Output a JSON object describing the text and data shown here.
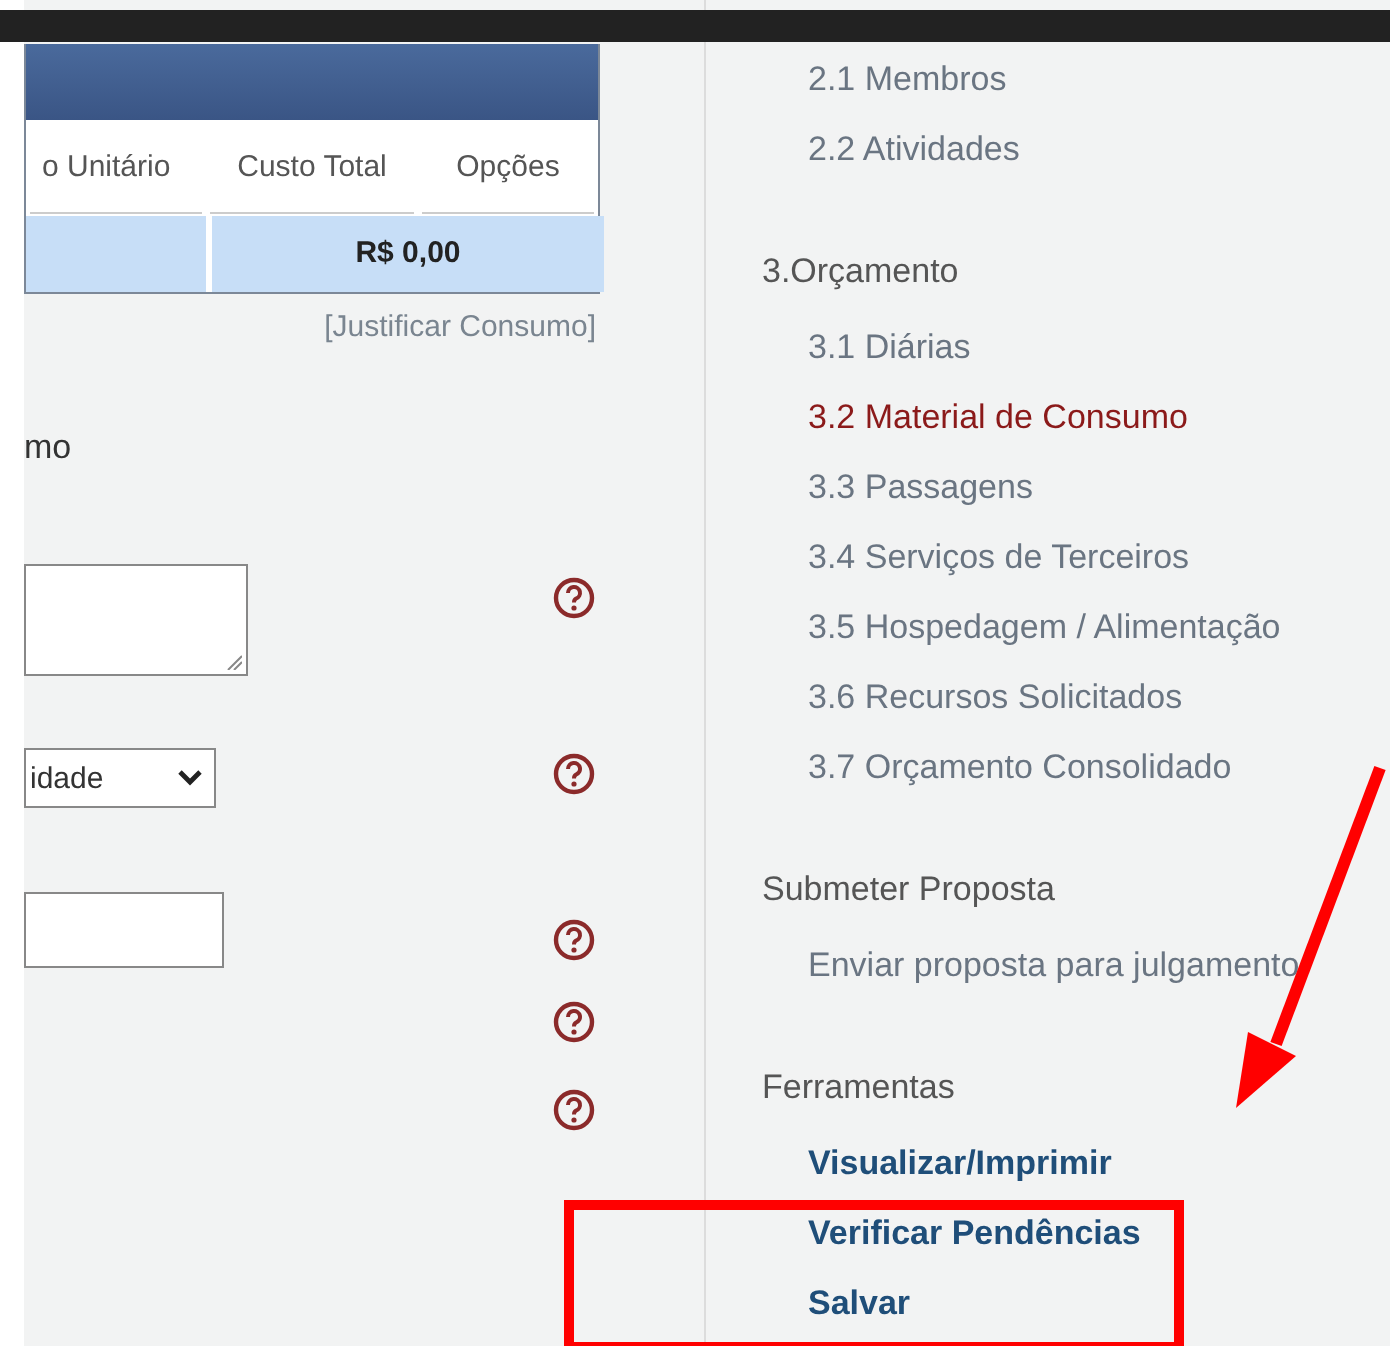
{
  "table": {
    "columns": [
      "o Unitário",
      "Custo Total",
      "Opções"
    ],
    "total": "R$ 0,00",
    "link": "[Justificar Consumo]"
  },
  "form": {
    "section_title": "mo",
    "fields": [
      {
        "kind": "textarea"
      },
      {
        "kind": "select",
        "value": "idade"
      },
      {
        "kind": "input"
      },
      {
        "kind": "none"
      },
      {
        "kind": "none"
      }
    ]
  },
  "sidebar": {
    "sections": [
      {
        "items": [
          {
            "label": "2.1 Membros",
            "kind": "page",
            "selected": false
          },
          {
            "label": "2.2 Atividades",
            "kind": "page",
            "selected": false
          }
        ]
      },
      {
        "title": "3.Orçamento",
        "items": [
          {
            "label": "3.1 Diárias",
            "kind": "page",
            "selected": false
          },
          {
            "label": "3.2 Material de Consumo",
            "kind": "page",
            "selected": true
          },
          {
            "label": "3.3 Passagens",
            "kind": "page",
            "selected": false
          },
          {
            "label": "3.4 Serviços de Terceiros",
            "kind": "page",
            "selected": false
          },
          {
            "label": "3.5 Hospedagem / Alimentação",
            "kind": "page",
            "selected": false
          },
          {
            "label": "3.6 Recursos Solicitados",
            "kind": "page",
            "selected": false
          },
          {
            "label": "3.7 Orçamento Consolidado",
            "kind": "page",
            "selected": false
          }
        ]
      },
      {
        "title": "Submeter Proposta",
        "items": [
          {
            "label": "Enviar proposta para julgamento",
            "kind": "page",
            "selected": false
          }
        ]
      },
      {
        "title": "Ferramentas",
        "items": [
          {
            "label": "Visualizar/Imprimir",
            "kind": "action",
            "selected": false
          },
          {
            "label": "Verificar Pendências",
            "kind": "action",
            "selected": false
          },
          {
            "label": "Salvar",
            "kind": "action",
            "selected": false
          }
        ]
      }
    ]
  },
  "annotations": [
    {
      "kind": "arrow"
    },
    {
      "kind": "box"
    }
  ]
}
